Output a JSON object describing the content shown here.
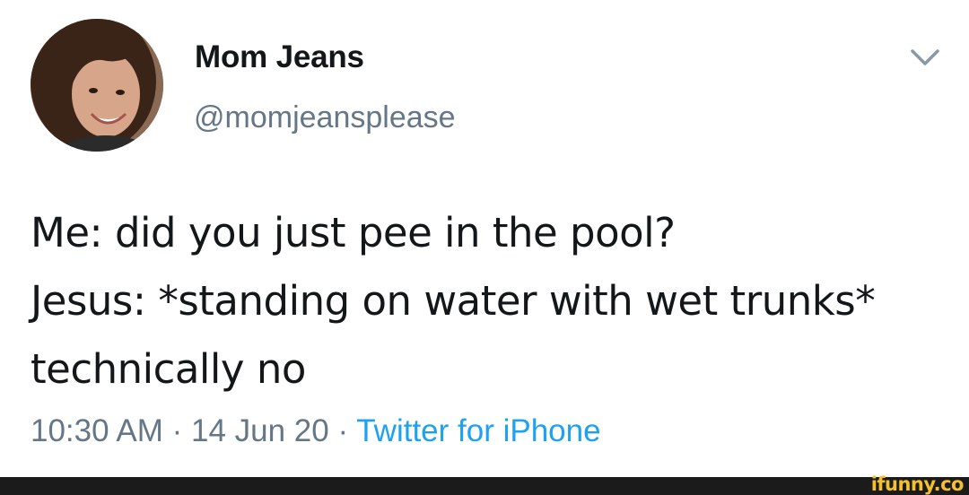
{
  "tweet": {
    "author": {
      "display_name": "Mom Jeans",
      "handle": "@momjeansplease",
      "avatar_icon": "profile-photo"
    },
    "text": "Me: did you just pee in the pool?\nJesus: *standing on water with wet trunks* technically no",
    "meta": {
      "time": "10:30 AM",
      "separator": " · ",
      "date": "14 Jun 20",
      "source": "Twitter for iPhone"
    },
    "menu_icon": "chevron-down-icon"
  },
  "watermark": {
    "text": "ifunny.co"
  },
  "colors": {
    "text_primary": "#14171a",
    "text_secondary": "#657786",
    "link": "#1da1f2",
    "watermark": "#f6c02c",
    "footer": "#1b1b1b"
  }
}
